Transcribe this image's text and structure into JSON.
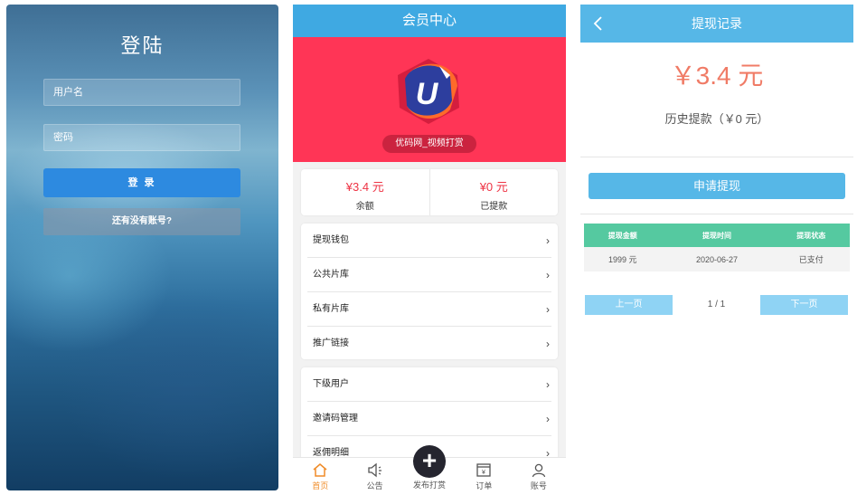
{
  "login": {
    "title": "登陆",
    "username_placeholder": "用户名",
    "password_placeholder": "密码",
    "login_button": "登 录",
    "register_link": "还有没有账号?"
  },
  "member": {
    "header_title": "会员中心",
    "site_name": "优码网_视频打赏",
    "logo_letter": "U",
    "balance_value": "¥3.4 元",
    "balance_label": "余额",
    "withdrawn_value": "¥0 元",
    "withdrawn_label": "已提款",
    "menu_a": [
      "提现钱包",
      "公共片库",
      "私有片库",
      "推广链接"
    ],
    "menu_b": [
      "下级用户",
      "邀请码管理",
      "返佣明细"
    ],
    "tabs": {
      "home": "首页",
      "notice": "公告",
      "publish": "发布打赏",
      "orders": "订单",
      "account": "账号"
    },
    "accent_color": "#ff3556"
  },
  "withdraw": {
    "header_title": "提现记录",
    "amount": "￥3.4 元",
    "history": "历史提款（￥0 元）",
    "apply_button": "申请提现",
    "table": {
      "headers": [
        "提现金额",
        "提现时间",
        "提现状态"
      ],
      "rows": [
        [
          "1999 元",
          "2020-06-27",
          "已支付"
        ]
      ]
    },
    "pager": {
      "prev": "上一页",
      "info": "1 / 1",
      "next": "下一页"
    }
  }
}
